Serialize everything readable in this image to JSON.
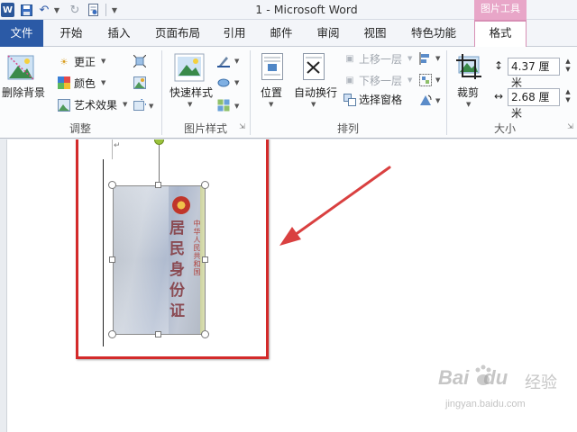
{
  "window": {
    "title": "1 - Microsoft Word",
    "context_tab_group": "图片工具",
    "app_icon_label": "W"
  },
  "tabs": [
    "文件",
    "开始",
    "插入",
    "页面布局",
    "引用",
    "邮件",
    "审阅",
    "视图",
    "特色功能",
    "格式"
  ],
  "ribbon": {
    "adjust": {
      "remove_bg": "删除背景",
      "corrections": "更正",
      "color": "颜色",
      "artistic": "艺术效果",
      "label": "调整"
    },
    "picture_styles": {
      "quick_styles": "快速样式",
      "label": "图片样式"
    },
    "arrange": {
      "position": "位置",
      "wrap": "自动换行",
      "bring_forward": "上移一层",
      "send_backward": "下移一层",
      "selection_pane": "选择窗格",
      "label": "排列"
    },
    "size": {
      "crop": "裁剪",
      "height": "4.37 厘米",
      "width": "2.68 厘米",
      "label": "大小"
    }
  },
  "document": {
    "card_small_text": "中华人民共和国",
    "card_big_text": "居民身份证"
  },
  "watermark": {
    "logo": "Bai",
    "logo_du": "du",
    "jingyan": "经验",
    "url": "jingyan.baidu.com"
  },
  "colors": {
    "file_tab": "#2b5aa6",
    "context_tab": "#e8a6c8",
    "highlight": "#d32a2a",
    "arrow": "#d94040"
  }
}
